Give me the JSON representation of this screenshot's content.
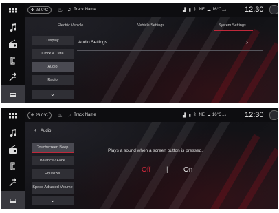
{
  "status": {
    "temperature": "23.0°C",
    "track_name": "Track Name",
    "compass": "NE",
    "outside_temp": "16°C",
    "outside_temp_suffix": "out",
    "time": "12:30"
  },
  "screen1": {
    "tabs": [
      {
        "label": "Electric Vehicle"
      },
      {
        "label": "Vehicle Settings"
      },
      {
        "label": "System Settings",
        "active": true
      }
    ],
    "menu": [
      {
        "label": "Display"
      },
      {
        "label": "Clock & Date"
      },
      {
        "label": "Audio",
        "active": true
      },
      {
        "label": "Radio"
      }
    ],
    "row_label": "Audio Settings"
  },
  "screen2": {
    "back_label": "Audio",
    "menu": [
      {
        "label": "Touchscreen Beep",
        "active": true
      },
      {
        "label": "Balance / Fade"
      },
      {
        "label": "Equalizer"
      },
      {
        "label": "Speed Adjusted Volume"
      }
    ],
    "description": "Plays a sound when a screen button is pressed.",
    "toggle": {
      "off": "Off",
      "on": "On",
      "selected": "Off"
    }
  },
  "colors": {
    "accent_red": "#c0283a",
    "background": "#121216"
  }
}
